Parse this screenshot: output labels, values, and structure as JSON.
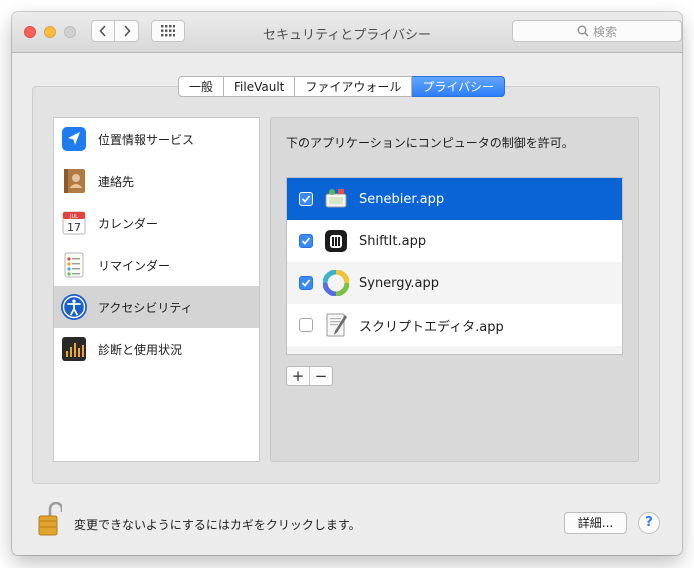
{
  "window": {
    "title": "セキュリティとプライバシー"
  },
  "toolbar": {
    "search_placeholder": "検索"
  },
  "tabs": [
    {
      "label": "一般",
      "active": false
    },
    {
      "label": "FileVault",
      "active": false
    },
    {
      "label": "ファイアウォール",
      "active": false
    },
    {
      "label": "プライバシー",
      "active": true
    }
  ],
  "sidebar": {
    "items": [
      {
        "label": "位置情報サービス",
        "icon": "location-icon",
        "selected": false
      },
      {
        "label": "連絡先",
        "icon": "contacts-icon",
        "selected": false
      },
      {
        "label": "カレンダー",
        "icon": "calendar-icon",
        "selected": false,
        "calendar_month": "JUL",
        "calendar_day": "17"
      },
      {
        "label": "リマインダー",
        "icon": "reminders-icon",
        "selected": false
      },
      {
        "label": "アクセシビリティ",
        "icon": "accessibility-icon",
        "selected": true
      },
      {
        "label": "診断と使用状況",
        "icon": "diagnostics-icon",
        "selected": false
      }
    ]
  },
  "main": {
    "instruction": "下のアプリケーションにコンピュータの制御を許可。",
    "apps": [
      {
        "name": "Senebier.app",
        "checked": true,
        "selected": true,
        "icon": "senebier-icon"
      },
      {
        "name": "ShiftIt.app",
        "checked": true,
        "selected": false,
        "icon": "shiftit-icon"
      },
      {
        "name": "Synergy.app",
        "checked": true,
        "selected": false,
        "icon": "synergy-icon"
      },
      {
        "name": "スクリプトエディタ.app",
        "checked": false,
        "selected": false,
        "icon": "script-editor-icon"
      }
    ],
    "add_label": "+",
    "remove_label": "−"
  },
  "footer": {
    "lock_text": "変更できないようにするにはカギをクリックします。",
    "detail_button": "詳細...",
    "help_button": "?"
  },
  "colors": {
    "accent": "#2d7ef7",
    "selection": "#0a64d6",
    "window_bg": "#ececec"
  }
}
